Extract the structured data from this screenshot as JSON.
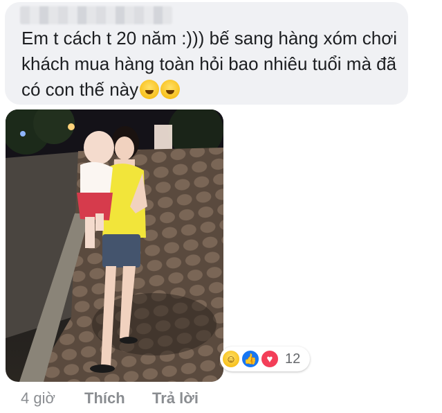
{
  "comment": {
    "text": "Em t cách t 20 năm :))) bế sang hàng xóm chơi khách mua hàng toàn hỏi bao nhiêu tuổi mà đã có con thế này",
    "emojis": [
      "laughing-tears-emoji",
      "laughing-tears-emoji"
    ]
  },
  "reactions": {
    "types": [
      "haha",
      "like",
      "love"
    ],
    "count": "12"
  },
  "footer": {
    "time": "4 giờ",
    "like_label": "Thích",
    "reply_label": "Trả lời"
  },
  "colors": {
    "bubble_bg": "#f0f1f4",
    "like_blue": "#1877f2",
    "love_red": "#f33e58",
    "meta_gray": "#8a8d91"
  }
}
